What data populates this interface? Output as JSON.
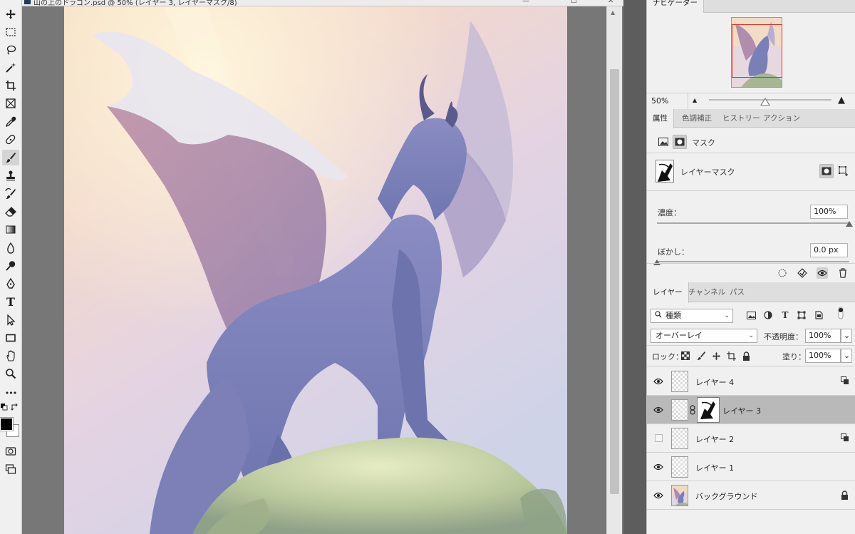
{
  "document": {
    "title": "山の上のドラゴン.psd @ 50% (レイヤー 3, レイヤーマスク/8)",
    "artwork": "dragon-on-hill-painting"
  },
  "toolbar": {
    "tools": [
      "move-icon",
      "marquee-icon",
      "lasso-icon",
      "magic-wand-icon",
      "crop-icon",
      "frame-icon",
      "eyedropper-icon",
      "healing-icon",
      "brush-icon",
      "stamp-icon",
      "history-brush-icon",
      "eraser-icon",
      "gradient-icon",
      "blur-icon",
      "dodge-icon",
      "pen-icon",
      "type-icon",
      "path-select-icon",
      "rectangle-icon",
      "hand-icon",
      "zoom-icon",
      "more-icon"
    ],
    "active_tool": "brush-icon",
    "type_glyph": "T",
    "more_glyph": "•••",
    "foreground_color": "#000000",
    "background_color": "#ffffff"
  },
  "navigator": {
    "tab": "ナビゲーター",
    "zoom": "50%"
  },
  "properties": {
    "tabs": [
      "属性",
      "色調補正",
      "ヒストリー",
      "アクション"
    ],
    "mask_label": "マスク",
    "layer_mask_label": "レイヤーマスク",
    "density_label": "濃度：",
    "density_value": "100%",
    "density_level": 1.0,
    "feather_label": "ぼかし：",
    "feather_value": "0.0 px",
    "feather_level": 0.0
  },
  "layers_panel": {
    "tabs": [
      "レイヤー",
      "チャンネル",
      "パス"
    ],
    "filter_kind": "種類",
    "blend_mode": "オーバーレイ",
    "opacity_label": "不透明度：",
    "opacity_value": "100%",
    "lock_label": "ロック：",
    "fill_label": "塗り：",
    "fill_value": "100%",
    "layers": [
      {
        "name": "レイヤー 4",
        "visible": true,
        "selected": false,
        "has_mask": false,
        "badge": "clip-icon"
      },
      {
        "name": "レイヤー 3",
        "visible": true,
        "selected": true,
        "has_mask": true,
        "badge": ""
      },
      {
        "name": "レイヤー 2",
        "visible": false,
        "selected": false,
        "has_mask": false,
        "badge": "clip-icon"
      },
      {
        "name": "レイヤー 1",
        "visible": true,
        "selected": false,
        "has_mask": false,
        "badge": ""
      },
      {
        "name": "バックグラウンド",
        "visible": true,
        "selected": false,
        "has_mask": false,
        "badge": "lock-icon"
      }
    ]
  },
  "colors": {
    "panel_bg": "#f0f0f0",
    "selected_layer": "#b9b9b9",
    "nav_rect": "#e0322a",
    "canvas_surround": "#777777"
  }
}
